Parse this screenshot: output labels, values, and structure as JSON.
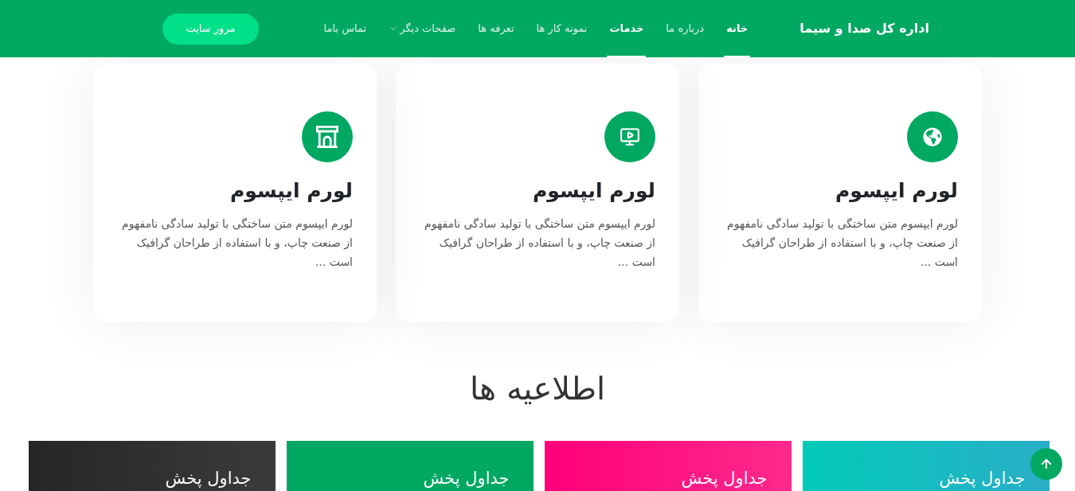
{
  "header": {
    "brand": "اداره کل صدا و سیما",
    "menu": [
      {
        "label": "خانه",
        "selected": true,
        "dropdown": false
      },
      {
        "label": "درباره ما",
        "selected": false,
        "dropdown": false
      },
      {
        "label": "خدمات",
        "selected": true,
        "dropdown": false
      },
      {
        "label": "نمونه کار ها",
        "selected": false,
        "dropdown": false
      },
      {
        "label": "تعرفه ها",
        "selected": false,
        "dropdown": false
      },
      {
        "label": "صفحات دیگر",
        "selected": false,
        "dropdown": true
      },
      {
        "label": "تماس باما",
        "selected": false,
        "dropdown": false
      }
    ],
    "button": "مرور سایت"
  },
  "services": [
    {
      "title": "لورم ایپسوم",
      "text": "لورم ایپسوم متن ساختگی با تولید سادگی نامفهوم از صنعت چاپ، و با استفاده از طراحان گرافیک است ..."
    },
    {
      "title": "لورم ایپسوم",
      "text": "لورم ایپسوم متن ساختگی با تولید سادگی نامفهوم از صنعت چاپ، و با استفاده از طراحان گرافیک است ..."
    },
    {
      "title": "لورم ایپسوم",
      "text": "لورم ایپسوم متن ساختگی با تولید سادگی نامفهوم از صنعت چاپ، و با استفاده از طراحان گرافیک است ..."
    }
  ],
  "announcements": {
    "title": "اطلاعیه ها",
    "items": [
      {
        "label": "جداول پخش"
      },
      {
        "label": "جداول پخش"
      },
      {
        "label": "جداول پخش"
      },
      {
        "label": "جداول پخش"
      }
    ]
  }
}
